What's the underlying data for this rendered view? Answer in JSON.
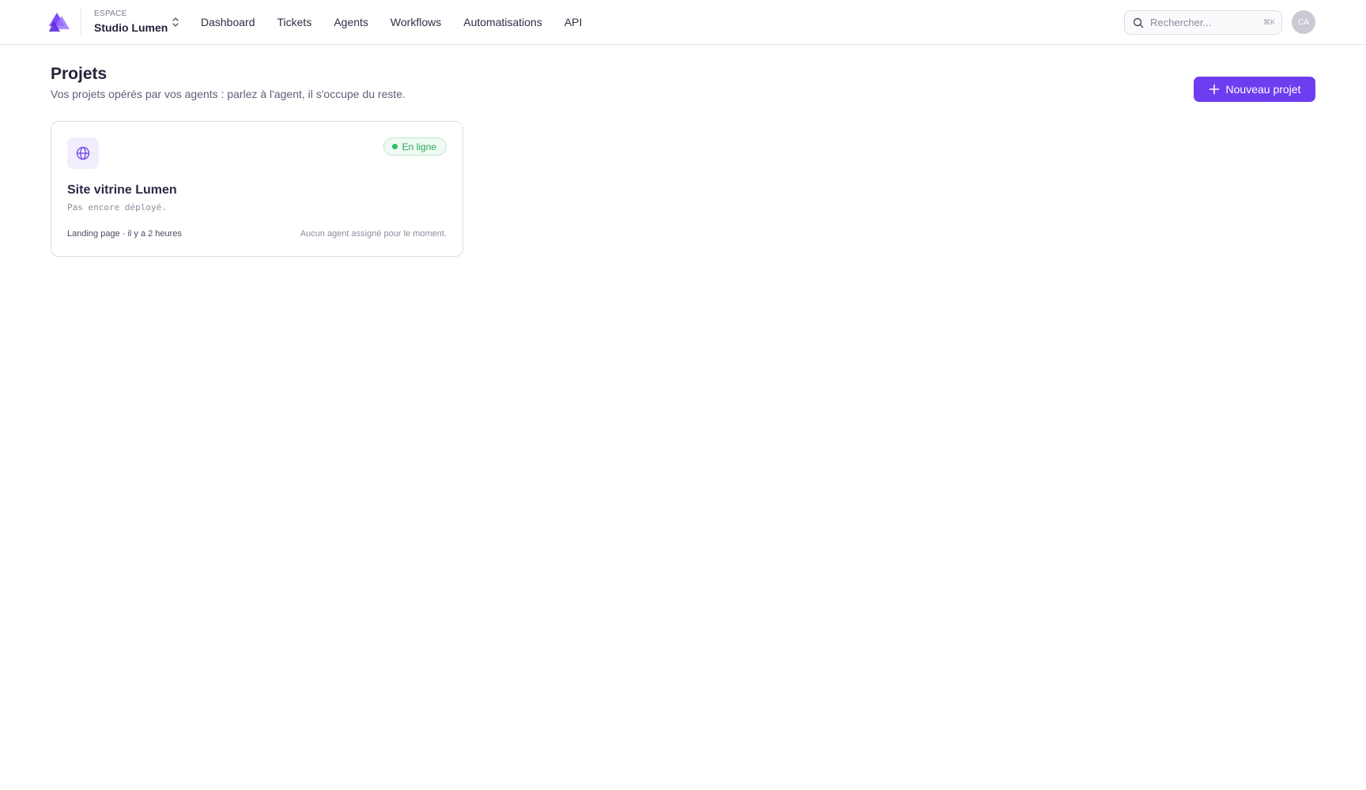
{
  "workspace": {
    "kicker": "ESPACE",
    "name": "Studio Lumen"
  },
  "nav": {
    "items": [
      {
        "label": "Dashboard"
      },
      {
        "label": "Tickets"
      },
      {
        "label": "Agents"
      },
      {
        "label": "Workflows"
      },
      {
        "label": "Automatisations"
      },
      {
        "label": "API"
      }
    ]
  },
  "search": {
    "placeholder": "Rechercher...",
    "shortcut": "⌘K"
  },
  "user": {
    "initials": "CA"
  },
  "header": {
    "title": "Projets",
    "subtitle": "Vos projets opérés par vos agents : parlez à l'agent, il s'occupe du reste.",
    "new_project_label": "Nouveau projet"
  },
  "projects": [
    {
      "icon": "globe-icon",
      "status": "En ligne",
      "title": "Site vitrine Lumen",
      "deploy_status": "Pas encore déployé.",
      "meta": "Landing page · il y a 2 heures",
      "agent": "Aucun agent assigné pour le moment."
    }
  ],
  "colors": {
    "accent": "#6d3ef0",
    "status_online": "#2fbf67"
  }
}
